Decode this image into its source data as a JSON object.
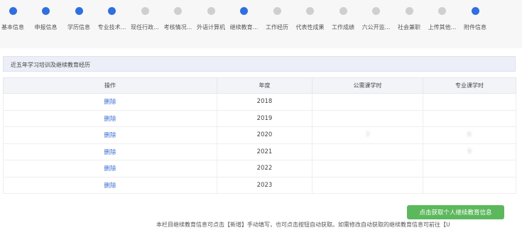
{
  "steps": [
    {
      "label": "基本信息",
      "done": true
    },
    {
      "label": "申报信息",
      "done": true
    },
    {
      "label": "学历信息",
      "done": true
    },
    {
      "label": "专业技术...",
      "done": true
    },
    {
      "label": "现任行政...",
      "done": false
    },
    {
      "label": "考核情况...",
      "done": false
    },
    {
      "label": "外语计算机",
      "done": false
    },
    {
      "label": "继续教育...",
      "done": true
    },
    {
      "label": "工作经历",
      "done": false
    },
    {
      "label": "代表性成果",
      "done": false
    },
    {
      "label": "工作成绩",
      "done": false
    },
    {
      "label": "六公开监...",
      "done": false
    },
    {
      "label": "社会兼职",
      "done": false
    },
    {
      "label": "上传其他...",
      "done": false
    },
    {
      "label": "附件信息",
      "done": true
    }
  ],
  "section_title": "近五年学习培训及继续教育经历",
  "table": {
    "headers": [
      "操作",
      "年度",
      "公需课学时",
      "专业课学时"
    ],
    "rows": [
      {
        "action": "删除",
        "year": "2018",
        "public_hours": "",
        "pro_hours": ""
      },
      {
        "action": "删除",
        "year": "2019",
        "public_hours": "",
        "pro_hours": ""
      },
      {
        "action": "删除",
        "year": "2020",
        "public_hours": "3",
        "pro_hours": "6"
      },
      {
        "action": "删除",
        "year": "2021",
        "public_hours": "",
        "pro_hours": "9"
      },
      {
        "action": "删除",
        "year": "2022",
        "public_hours": "",
        "pro_hours": ""
      },
      {
        "action": "删除",
        "year": "2023",
        "public_hours": "",
        "pro_hours": ""
      }
    ]
  },
  "fetch_button_label": "点击获取个人继续教育信息",
  "footer_note": "本栏目继续教育信息可点击【新增】手动填写，也可点击按钮自动获取。如需修改自动获取的继续教育信息可前往【U"
}
